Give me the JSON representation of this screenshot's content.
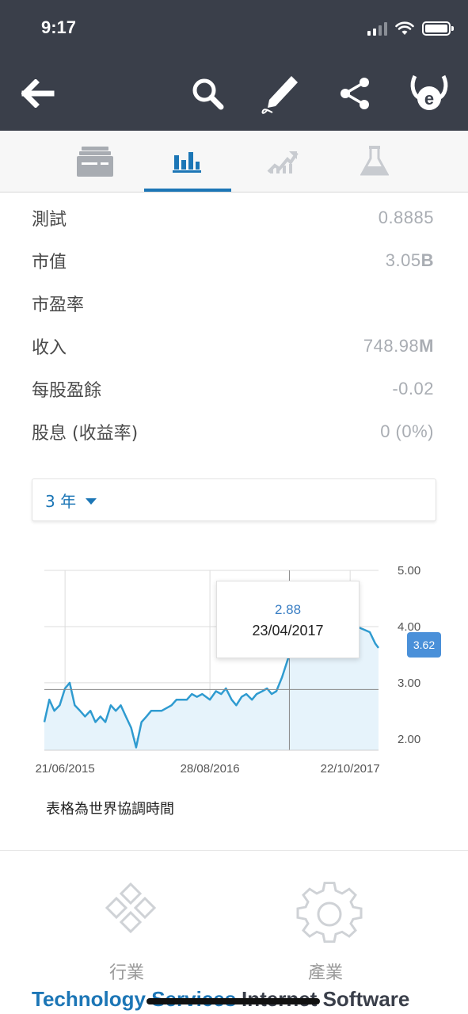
{
  "status_bar": {
    "time": "9:17"
  },
  "app_bar": {
    "icons": [
      "back-arrow-icon",
      "search-icon",
      "pen-icon",
      "share-icon",
      "etoro-logo-icon"
    ]
  },
  "tabs": [
    {
      "name": "overview",
      "icon": "news-feed-icon"
    },
    {
      "name": "stats",
      "icon": "bar-chart-icon",
      "active": true
    },
    {
      "name": "chart",
      "icon": "trend-up-icon"
    },
    {
      "name": "research",
      "icon": "flask-icon"
    }
  ],
  "stats": [
    {
      "label": "測試",
      "value": "0.8885"
    },
    {
      "label": "市值",
      "value": "3.05",
      "suffix": "B"
    },
    {
      "label": "市盈率",
      "value": ""
    },
    {
      "label": "收入",
      "value": "748.98",
      "suffix": "M"
    },
    {
      "label": "每股盈餘",
      "value": "-0.02"
    },
    {
      "label": "股息 (收益率)",
      "value": "0 (0%)"
    }
  ],
  "period_selector": {
    "selected": "3 年"
  },
  "chart_note": "表格為世界協調時間",
  "colors": {
    "accent": "#1c76b6",
    "chart_line": "#2f9bd0",
    "chart_fill": "#e6f3fb",
    "app_bar": "#3a3f4a"
  },
  "chart_data": {
    "type": "area",
    "title": "",
    "xlabel": "",
    "ylabel": "",
    "ylim": [
      1.8,
      5.0
    ],
    "yticks": [
      "5.00",
      "4.00",
      "3.00",
      "2.00"
    ],
    "xticks": [
      "21/06/2015",
      "28/08/2016",
      "22/10/2017"
    ],
    "grid": true,
    "legend": "none",
    "x_range": [
      "2015-04-20",
      "2018-01-15"
    ],
    "series": [
      {
        "x": [
          "2015-04-20",
          "2015-05-05",
          "2015-05-20",
          "2015-06-05",
          "2015-06-21",
          "2015-07-05",
          "2015-07-20",
          "2015-08-05",
          "2015-08-20",
          "2015-09-05",
          "2015-09-20",
          "2015-10-05",
          "2015-10-20",
          "2015-11-05",
          "2015-11-20",
          "2015-12-05",
          "2015-12-20",
          "2016-01-05",
          "2016-01-20",
          "2016-02-05",
          "2016-02-20",
          "2016-03-05",
          "2016-03-20",
          "2016-04-05",
          "2016-04-20",
          "2016-05-05",
          "2016-05-20",
          "2016-06-05",
          "2016-06-20",
          "2016-07-05",
          "2016-07-20",
          "2016-08-05",
          "2016-08-28",
          "2016-09-15",
          "2016-10-01",
          "2016-10-15",
          "2016-11-01",
          "2016-11-15",
          "2016-12-01",
          "2016-12-15",
          "2017-01-01",
          "2017-01-15",
          "2017-02-01",
          "2017-02-15",
          "2017-03-01",
          "2017-03-15",
          "2017-04-01",
          "2017-04-23",
          "2017-05-10",
          "2017-06-01",
          "2017-06-20",
          "2017-07-10",
          "2017-08-01",
          "2017-08-20",
          "2017-09-10",
          "2017-10-01",
          "2017-10-22",
          "2017-11-10",
          "2017-12-01",
          "2017-12-20",
          "2018-01-05",
          "2018-01-15"
        ],
        "y": [
          2.3,
          2.7,
          2.5,
          2.6,
          2.9,
          3.0,
          2.6,
          2.5,
          2.4,
          2.5,
          2.3,
          2.4,
          2.3,
          2.6,
          2.5,
          2.6,
          2.4,
          2.2,
          1.85,
          2.3,
          2.4,
          2.5,
          2.5,
          2.5,
          2.55,
          2.6,
          2.7,
          2.7,
          2.7,
          2.8,
          2.75,
          2.8,
          2.7,
          2.85,
          2.8,
          2.9,
          2.7,
          2.6,
          2.75,
          2.8,
          2.7,
          2.8,
          2.85,
          2.9,
          2.8,
          2.85,
          3.1,
          3.5,
          3.6,
          3.8,
          3.9,
          3.8,
          3.85,
          3.9,
          3.95,
          4.0,
          3.9,
          4.0,
          3.95,
          3.9,
          3.7,
          3.62
        ]
      }
    ],
    "highlight": {
      "value": "2.88",
      "date": "23/04/2017"
    },
    "last_value": "3.62"
  },
  "sector": {
    "label": "行業",
    "value": "Technology Services",
    "icon": "sector-diamond-icon"
  },
  "industry": {
    "label": "產業",
    "value": "Internet Software",
    "icon": "gear-icon"
  }
}
